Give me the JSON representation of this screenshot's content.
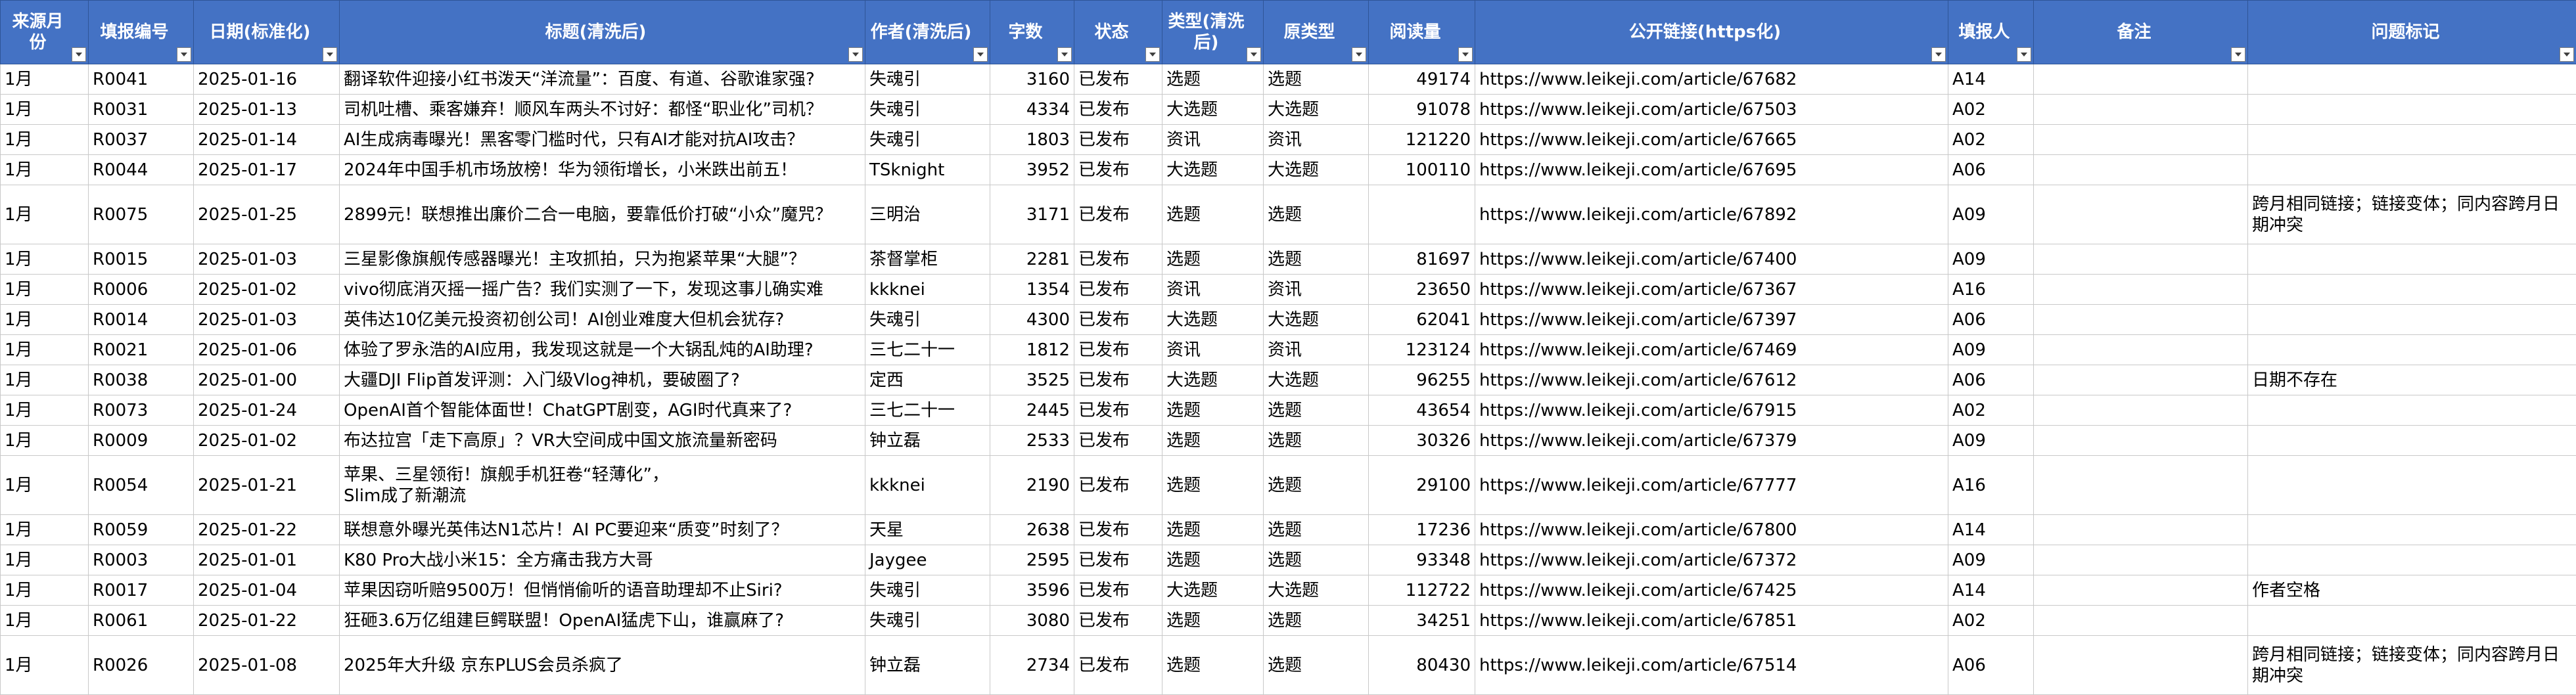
{
  "columns": [
    {
      "label": "来源月份",
      "name": "col-source-month"
    },
    {
      "label": "填报编号",
      "name": "col-report-id"
    },
    {
      "label": "日期(标准化)",
      "name": "col-date"
    },
    {
      "label": "标题(清洗后)",
      "name": "col-title"
    },
    {
      "label": "作者(清洗后)",
      "name": "col-author"
    },
    {
      "label": "字数",
      "name": "col-word-count"
    },
    {
      "label": "状态",
      "name": "col-status"
    },
    {
      "label": "类型(清洗后)",
      "name": "col-type"
    },
    {
      "label": "原类型",
      "name": "col-orig-type"
    },
    {
      "label": "阅读量",
      "name": "col-views"
    },
    {
      "label": "公开链接(https化)",
      "name": "col-link"
    },
    {
      "label": "填报人",
      "name": "col-reporter"
    },
    {
      "label": "备注",
      "name": "col-notes"
    },
    {
      "label": "问题标记",
      "name": "col-issue"
    }
  ],
  "rows": [
    [
      "1月",
      "R0041",
      "2025-01-16",
      "翻译软件迎接小红书泼天“洋流量”：百度、有道、谷歌谁家强?",
      "失魂引",
      "3160",
      "已发布",
      "选题",
      "选题",
      "49174",
      "https://www.leikeji.com/article/67682",
      "A14",
      "",
      ""
    ],
    [
      "1月",
      "R0031",
      "2025-01-13",
      "司机吐槽、乘客嫌弃！顺风车两头不讨好：都怪“职业化”司机？",
      "失魂引",
      "4334",
      "已发布",
      "大选题",
      "大选题",
      "91078",
      "https://www.leikeji.com/article/67503",
      "A02",
      "",
      ""
    ],
    [
      "1月",
      "R0037",
      "2025-01-14",
      "AI生成病毒曝光！黑客零门槛时代，只有AI才能对抗AI攻击？",
      "失魂引",
      "1803",
      "已发布",
      "资讯",
      "资讯",
      "121220",
      "https://www.leikeji.com/article/67665",
      "A02",
      "",
      ""
    ],
    [
      "1月",
      "R0044",
      "2025-01-17",
      "2024年中国手机市场放榜！华为领衔增长，小米跌出前五！",
      "TSknight",
      "3952",
      "已发布",
      "大选题",
      "大选题",
      "100110",
      "https://www.leikeji.com/article/67695",
      "A06",
      "",
      ""
    ],
    [
      "1月",
      "R0075",
      "2025-01-25",
      "2899元！联想推出廉价二合一电脑，要靠低价打破“小众”魔咒？",
      "三明治",
      "3171",
      "已发布",
      "选题",
      "选题",
      "",
      "https://www.leikeji.com/article/67892",
      "A09",
      "",
      "跨月相同链接；链接变体；同内容跨月日期冲突"
    ],
    [
      "1月",
      "R0015",
      "2025-01-03",
      "三星影像旗舰传感器曝光！主攻抓拍，只为抱紧苹果“大腿”？",
      "茶督掌柜",
      "2281",
      "已发布",
      "选题",
      "选题",
      "81697",
      "https://www.leikeji.com/article/67400",
      "A09",
      "",
      ""
    ],
    [
      "1月",
      "R0006",
      "2025-01-02",
      "vivo彻底消灭摇一摇广告？我们实测了一下，发现这事儿确实难",
      "kkknei",
      "1354",
      "已发布",
      "资讯",
      "资讯",
      "23650",
      "https://www.leikeji.com/article/67367",
      "A16",
      "",
      ""
    ],
    [
      "1月",
      "R0014",
      "2025-01-03",
      "英伟达10亿美元投资初创公司！AI创业难度大但机会犹存?",
      "失魂引",
      "4300",
      "已发布",
      "大选题",
      "大选题",
      "62041",
      "https://www.leikeji.com/article/67397",
      "A06",
      "",
      ""
    ],
    [
      "1月",
      "R0021",
      "2025-01-06",
      "体验了罗永浩的AI应用，我发现这就是一个大锅乱炖的AI助理?",
      "三七二十一",
      "1812",
      "已发布",
      "资讯",
      "资讯",
      "123124",
      "https://www.leikeji.com/article/67469",
      "A09",
      "",
      ""
    ],
    [
      "1月",
      "R0038",
      "2025-01-00",
      "大疆DJI Flip首发评测：入门级Vlog神机，要破圈了?",
      "定西",
      "3525",
      "已发布",
      "大选题",
      "大选题",
      "96255",
      "https://www.leikeji.com/article/67612",
      "A06",
      "",
      "日期不存在"
    ],
    [
      "1月",
      "R0073",
      "2025-01-24",
      "OpenAI首个智能体面世！ChatGPT剧变，AGI时代真来了?",
      "三七二十一",
      "2445",
      "已发布",
      "选题",
      "选题",
      "43654",
      "https://www.leikeji.com/article/67915",
      "A02",
      "",
      ""
    ],
    [
      "1月",
      "R0009",
      "2025-01-02",
      "布达拉宫「走下高原」？VR大空间成中国文旅流量新密码",
      "钟立磊",
      "2533",
      "已发布",
      "选题",
      "选题",
      "30326",
      "https://www.leikeji.com/article/67379",
      "A09",
      "",
      ""
    ],
    [
      "1月",
      "R0054",
      "2025-01-21",
      "苹果、三星领衔！旗舰手机狂卷“轻薄化”，\nSlim成了新潮流",
      "kkknei",
      "2190",
      "已发布",
      "选题",
      "选题",
      "29100",
      "https://www.leikeji.com/article/67777",
      "A16",
      "",
      ""
    ],
    [
      "1月",
      "R0059",
      "2025-01-22",
      "联想意外曝光英伟达N1芯片！AI PC要迎来“质变”时刻了？",
      "天星",
      "2638",
      "已发布",
      "选题",
      "选题",
      "17236",
      "https://www.leikeji.com/article/67800",
      "A14",
      "",
      ""
    ],
    [
      "1月",
      "R0003",
      "2025-01-01",
      "K80 Pro大战小米15：全方痛击我方大哥",
      "Jaygee",
      "2595",
      "已发布",
      "选题",
      "选题",
      "93348",
      "https://www.leikeji.com/article/67372",
      "A09",
      "",
      ""
    ],
    [
      "1月",
      "R0017",
      "2025-01-04",
      "苹果因窃听赔9500万！但悄悄偷听的语音助理却不止Siri?",
      "失魂引",
      "3596",
      "已发布",
      "大选题",
      "大选题",
      "112722",
      "https://www.leikeji.com/article/67425",
      "A14",
      "",
      "作者空格"
    ],
    [
      "1月",
      "R0061",
      "2025-01-22",
      "狂砸3.6万亿组建巨鳄联盟！OpenAI猛虎下山，谁赢麻了?",
      "失魂引",
      "3080",
      "已发布",
      "选题",
      "选题",
      "34251",
      "https://www.leikeji.com/article/67851",
      "A02",
      "",
      ""
    ],
    [
      "1月",
      "R0026",
      "2025-01-08",
      "2025年大升级 京东PLUS会员杀疯了",
      "钟立磊",
      "2734",
      "已发布",
      "选题",
      "选题",
      "80430",
      "https://www.leikeji.com/article/67514",
      "A06",
      "",
      "跨月相同链接；链接变体；同内容跨月日期冲突"
    ]
  ]
}
